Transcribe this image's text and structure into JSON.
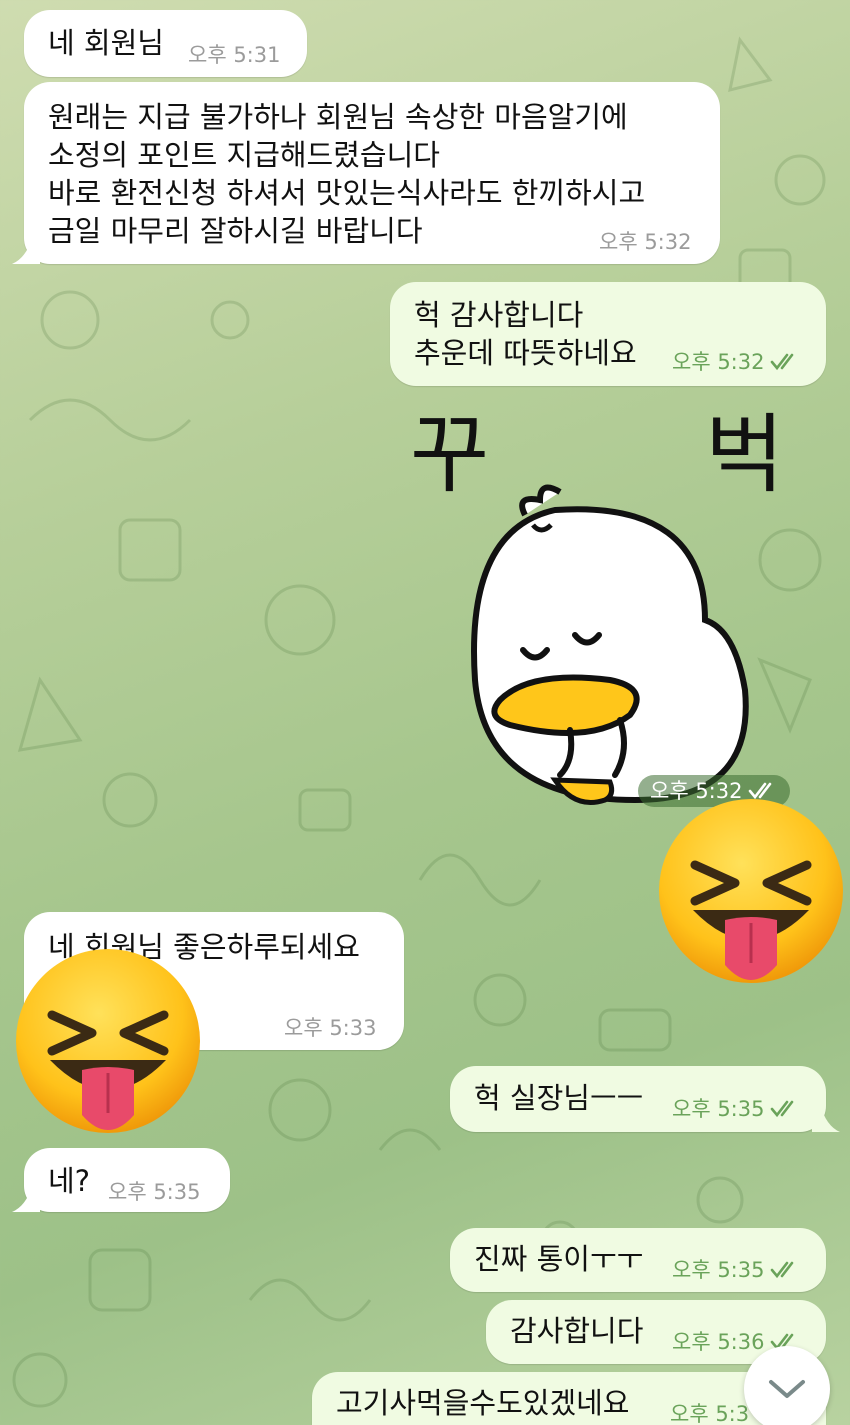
{
  "messages": [
    {
      "text": "네 회원님",
      "time": "오후 5:31"
    },
    {
      "text": "원래는 지급 불가하나 회원님 속상한 마음알기에\n소정의 포인트 지급해드렸습니다\n바로 환전신청 하셔서 맛있는식사라도 한끼하시고\n금일 마무리 잘하시길 바랍니다",
      "time": "오후 5:32"
    },
    {
      "text": "헉 감사합니다\n추운데 따뜻하네요",
      "time": "오후 5:32"
    },
    {
      "sticker_text_left": "꾸",
      "sticker_text_right": "벅",
      "time": "오후 5:32"
    },
    {
      "text": "네 회원님 좋은하루되세요",
      "time": "오후 5:33"
    },
    {
      "text": "헉 실장님ㅡㅡ",
      "time": "오후 5:35"
    },
    {
      "text": "네?",
      "time": "오후 5:35"
    },
    {
      "text": "진짜 통이ㅜㅜ",
      "time": "오후 5:35"
    },
    {
      "text": "감사합니다",
      "time": "오후 5:36"
    },
    {
      "text": "고기사먹을수도있겠네요",
      "time": "오후 5:3"
    }
  ],
  "icons": {
    "read_receipt": "double-check-icon",
    "scroll_down": "chevron-down-icon",
    "emoji": "squinting-face-with-tongue"
  },
  "colors": {
    "incoming_bubble": "#ffffff",
    "outgoing_bubble": "#f0fbe2",
    "outgoing_meta": "#6aa35a",
    "incoming_meta": "#9b9b9b"
  }
}
